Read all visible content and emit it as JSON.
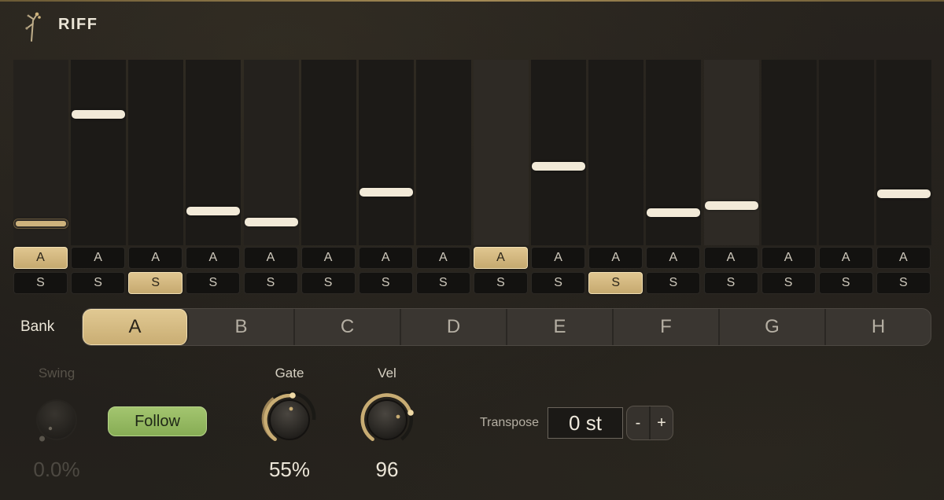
{
  "app": {
    "title": "RIFF"
  },
  "steps": [
    {
      "note_level": 0.92,
      "note_active": true,
      "a": "A",
      "a_on": true,
      "s": "S",
      "s_on": false
    },
    {
      "note_level": 0.33,
      "note_active": false,
      "a": "A",
      "a_on": false,
      "s": "S",
      "s_on": false
    },
    {
      "note_level": null,
      "note_active": false,
      "a": "A",
      "a_on": false,
      "s": "S",
      "s_on": true
    },
    {
      "note_level": 0.85,
      "note_active": false,
      "a": "A",
      "a_on": false,
      "s": "S",
      "s_on": false
    },
    {
      "note_level": 0.91,
      "note_active": false,
      "a": "A",
      "a_on": false,
      "s": "S",
      "s_on": false
    },
    {
      "note_level": null,
      "note_active": false,
      "a": "A",
      "a_on": false,
      "s": "S",
      "s_on": false
    },
    {
      "note_level": 0.75,
      "note_active": false,
      "a": "A",
      "a_on": false,
      "s": "S",
      "s_on": false
    },
    {
      "note_level": null,
      "note_active": false,
      "a": "A",
      "a_on": false,
      "s": "S",
      "s_on": false
    },
    {
      "note_level": null,
      "note_active": false,
      "a": "A",
      "a_on": true,
      "s": "S",
      "s_on": false
    },
    {
      "note_level": 0.61,
      "note_active": false,
      "a": "A",
      "a_on": false,
      "s": "S",
      "s_on": false
    },
    {
      "note_level": null,
      "note_active": false,
      "a": "A",
      "a_on": false,
      "s": "S",
      "s_on": true
    },
    {
      "note_level": 0.86,
      "note_active": false,
      "a": "A",
      "a_on": false,
      "s": "S",
      "s_on": false
    },
    {
      "note_level": 0.82,
      "note_active": false,
      "a": "A",
      "a_on": false,
      "s": "S",
      "s_on": false
    },
    {
      "note_level": null,
      "note_active": false,
      "a": "A",
      "a_on": false,
      "s": "S",
      "s_on": false
    },
    {
      "note_level": null,
      "note_active": false,
      "a": "A",
      "a_on": false,
      "s": "S",
      "s_on": false
    },
    {
      "note_level": 0.76,
      "note_active": false,
      "a": "A",
      "a_on": false,
      "s": "S",
      "s_on": false
    }
  ],
  "bank": {
    "label": "Bank",
    "tabs": [
      "A",
      "B",
      "C",
      "D",
      "E",
      "F",
      "G",
      "H"
    ],
    "selected": "A"
  },
  "swing": {
    "label": "Swing",
    "value": "0.0%",
    "level": 0.0,
    "enabled": false
  },
  "follow": {
    "label": "Follow"
  },
  "gate": {
    "label": "Gate",
    "value": "55%",
    "level": 0.55
  },
  "vel": {
    "label": "Vel",
    "value": "96",
    "level": 0.75
  },
  "transpose": {
    "label": "Transpose",
    "value": "0 st",
    "minus": "-",
    "plus": "+"
  },
  "colors": {
    "accent_gold": "#cdb27c",
    "follow_green": "#93b860",
    "background": "#23201c",
    "note_white": "#f2ead8"
  }
}
